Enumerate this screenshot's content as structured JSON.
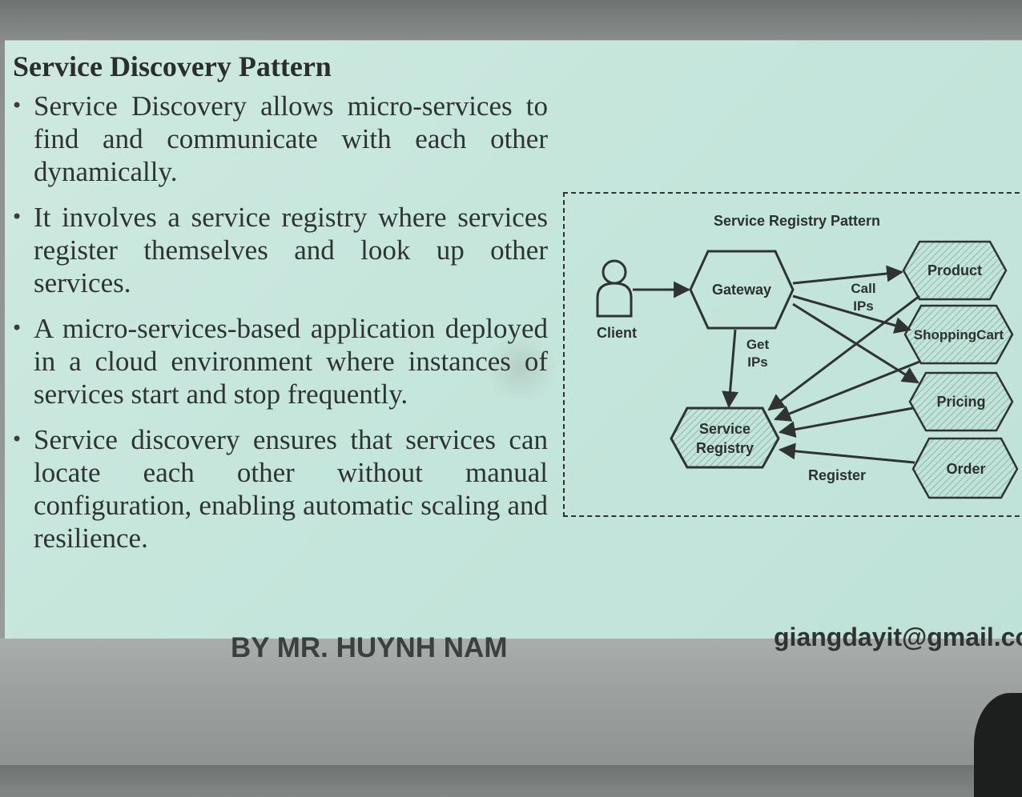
{
  "slide": {
    "title": "Service Discovery Pattern",
    "bullets": [
      "Service Discovery allows micro-services to find and communicate with each other dynamically.",
      "It involves a service registry where services register themselves and look up other services.",
      "A micro-services-based application deployed in a cloud environment where instances of services start and stop frequently.",
      "Service discovery ensures that services can locate each other without manual configuration, enabling automatic scaling and resilience."
    ],
    "bullet_symbol": "•"
  },
  "diagram": {
    "title": "Service Registry Pattern",
    "client_label": "Client",
    "gateway_label": "Gateway",
    "registry_label_line1": "Service",
    "registry_label_line2": "Registry",
    "get_ips_line1": "Get",
    "get_ips_line2": "IPs",
    "call_ips_line1": "Call",
    "call_ips_line2": "IPs",
    "register_label": "Register",
    "services": [
      "Product",
      "ShoppingCart",
      "Pricing",
      "Order"
    ],
    "icons": [
      "person-icon"
    ]
  },
  "footer": {
    "author": "BY MR. HUYNH NAM",
    "email": "giangdayit@gmail.con"
  }
}
